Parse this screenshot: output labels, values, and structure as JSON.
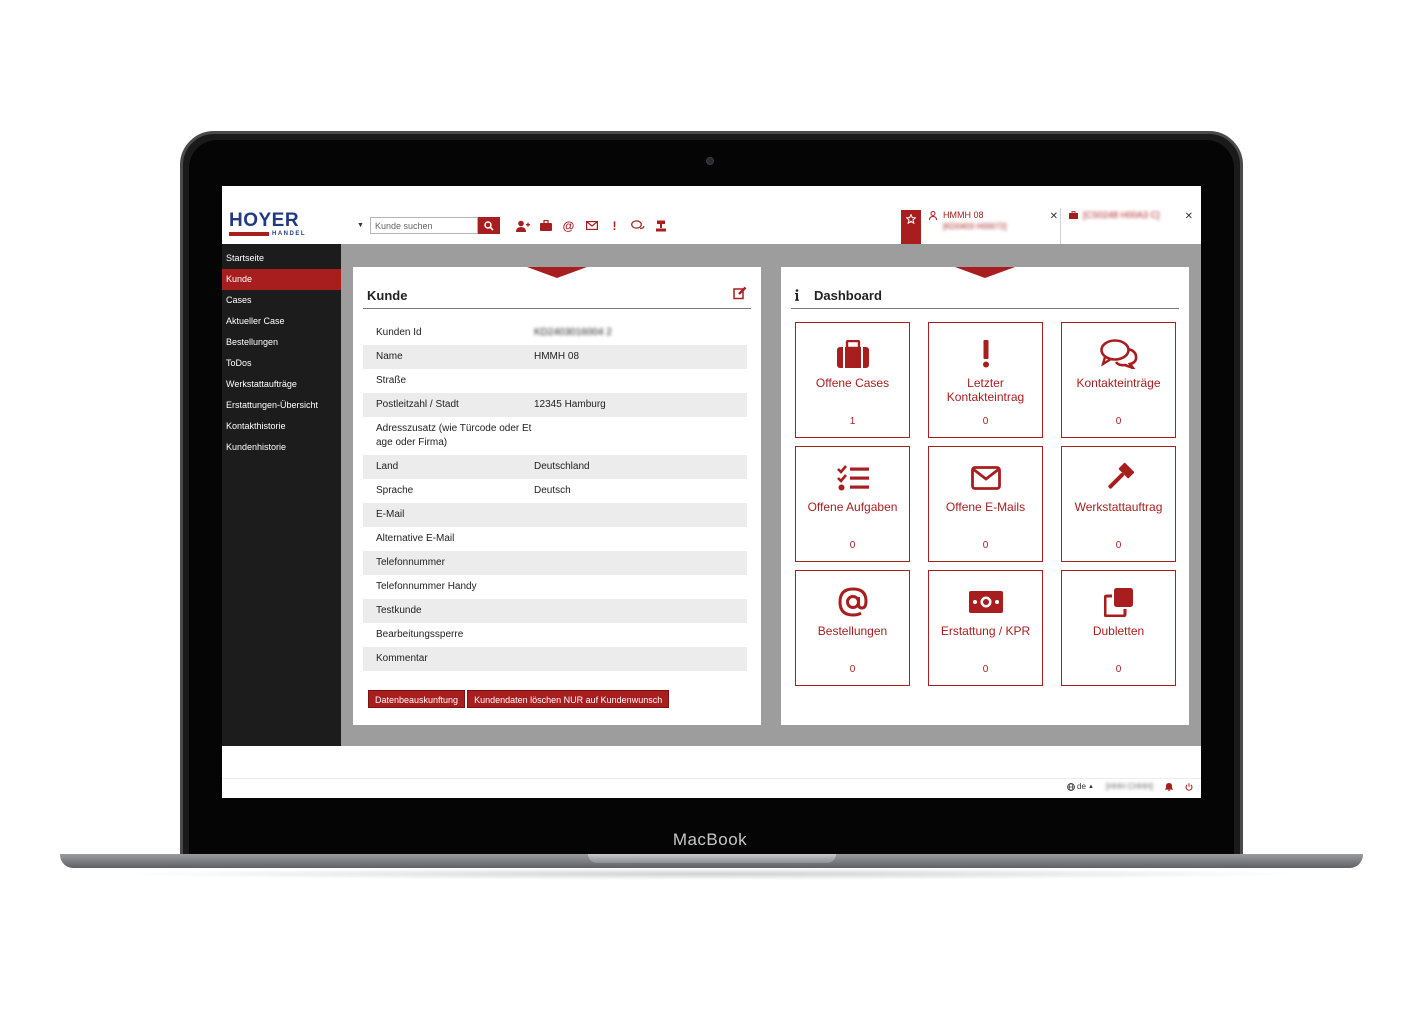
{
  "device": {
    "label": "MacBook"
  },
  "brand": {
    "logo_text": "HOYER",
    "logo_sub": "HANDEL"
  },
  "search": {
    "placeholder": "Kunde suchen"
  },
  "open_tabs": [
    {
      "title": "HMMH 08",
      "subtitle": "[KD0403 H00072]"
    },
    {
      "title": "[CS0248 H00A3 C]"
    }
  ],
  "sidebar": {
    "items": [
      {
        "label": "Startseite",
        "active": false
      },
      {
        "label": "Kunde",
        "active": true
      },
      {
        "label": "Cases",
        "active": false
      },
      {
        "label": "Aktueller Case",
        "active": false
      },
      {
        "label": "Bestellungen",
        "active": false
      },
      {
        "label": "ToDos",
        "active": false
      },
      {
        "label": "Werkstattaufträge",
        "active": false
      },
      {
        "label": "Erstattungen-Übersicht",
        "active": false
      },
      {
        "label": "Kontakthistorie",
        "active": false
      },
      {
        "label": "Kundenhistorie",
        "active": false
      }
    ]
  },
  "kunde": {
    "title": "Kunde",
    "rows": [
      {
        "label": "Kunden Id",
        "value": "KD2403016004 2",
        "blurred": true
      },
      {
        "label": "Name",
        "value": "HMMH 08"
      },
      {
        "label": "Straße",
        "value": ""
      },
      {
        "label": "Postleitzahl / Stadt",
        "value": "12345 Hamburg"
      },
      {
        "label": "Adresszusatz (wie Türcode oder Etage oder Firma)",
        "value": ""
      },
      {
        "label": "Land",
        "value": "Deutschland"
      },
      {
        "label": "Sprache",
        "value": "Deutsch"
      },
      {
        "label": "E-Mail",
        "value": ""
      },
      {
        "label": "Alternative E-Mail",
        "value": ""
      },
      {
        "label": "Telefonnummer",
        "value": ""
      },
      {
        "label": "Telefonnummer Handy",
        "value": ""
      },
      {
        "label": "Testkunde",
        "value": ""
      },
      {
        "label": "Bearbeitungssperre",
        "value": ""
      },
      {
        "label": "Kommentar",
        "value": ""
      }
    ],
    "buttons": [
      "Datenbeauskunftung",
      "Kundendaten löschen NUR auf Kundenwunsch"
    ]
  },
  "dashboard": {
    "title": "Dashboard",
    "tiles": [
      {
        "label": "Offene Cases",
        "count": "1",
        "icon": "briefcase-icon"
      },
      {
        "label": "Letzter Kontakteintrag",
        "count": "0",
        "icon": "exclamation-icon"
      },
      {
        "label": "Kontakteinträge",
        "count": "0",
        "icon": "comments-icon"
      },
      {
        "label": "Offene Aufgaben",
        "count": "0",
        "icon": "tasks-icon"
      },
      {
        "label": "Offene E-Mails",
        "count": "0",
        "icon": "envelope-icon"
      },
      {
        "label": "Werkstattauftrag",
        "count": "0",
        "icon": "gavel-icon"
      },
      {
        "label": "Bestellungen",
        "count": "0",
        "icon": "at-icon"
      },
      {
        "label": "Erstattung / KPR",
        "count": "0",
        "icon": "money-icon"
      },
      {
        "label": "Dubletten",
        "count": "0",
        "icon": "clone-icon"
      }
    ]
  },
  "footer": {
    "language": "de",
    "user": "[HHH CHHH]"
  },
  "colors": {
    "accent": "#a81e1e",
    "logo_blue": "#1f3b87",
    "sidebar_bg": "#1c1c1c",
    "content_bg": "#9d9d9d"
  }
}
